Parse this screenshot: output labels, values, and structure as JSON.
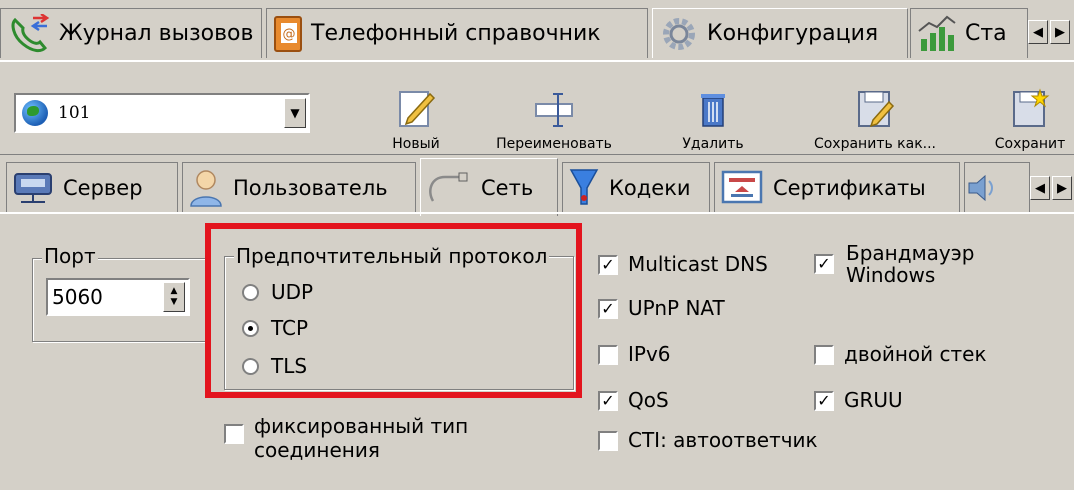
{
  "top_tabs": [
    {
      "label": "Журнал вызовов",
      "icon": "phone-icon"
    },
    {
      "label": "Телефонный справочник",
      "icon": "address-book-icon"
    },
    {
      "label": "Конфигурация",
      "icon": "gear-icon"
    },
    {
      "label": "Ста",
      "icon": "statistics-icon"
    }
  ],
  "toolbar": {
    "account_value": "101",
    "buttons": [
      {
        "label": "Новый",
        "icon": "pencil-icon"
      },
      {
        "label": "Переименовать",
        "icon": "rename-icon"
      },
      {
        "label": "Удалить",
        "icon": "trash-icon"
      },
      {
        "label": "Сохранить как...",
        "icon": "save-as-icon"
      },
      {
        "label": "Сохранит",
        "icon": "save-icon"
      }
    ]
  },
  "sub_tabs": [
    {
      "label": "Сервер",
      "icon": "server-icon"
    },
    {
      "label": "Пользователь",
      "icon": "user-icon"
    },
    {
      "label": "Сеть",
      "icon": "network-icon"
    },
    {
      "label": "Кодеки",
      "icon": "codec-icon"
    },
    {
      "label": "Сертификаты",
      "icon": "certificate-icon"
    }
  ],
  "port": {
    "label": "Порт",
    "value": "5060"
  },
  "protocol": {
    "label": "Предпочтительный протокол",
    "options": [
      "UDP",
      "TCP",
      "TLS"
    ],
    "selected": "TCP"
  },
  "fixed_connection_label": "фиксированный тип\nсоединения",
  "checkboxes": [
    {
      "label": "Multicast DNS",
      "checked": true
    },
    {
      "label": "Брандмауэр\nWindows",
      "checked": true
    },
    {
      "label": "UPnP NAT",
      "checked": true
    },
    {
      "label": "IPv6",
      "checked": false
    },
    {
      "label": "двойной стек",
      "checked": false
    },
    {
      "label": "QoS",
      "checked": true
    },
    {
      "label": "GRUU",
      "checked": true
    },
    {
      "label": "CTI: автоответчик",
      "checked": false
    }
  ],
  "colors": {
    "highlight": "#e3141e",
    "window": "#d4d0c8"
  }
}
